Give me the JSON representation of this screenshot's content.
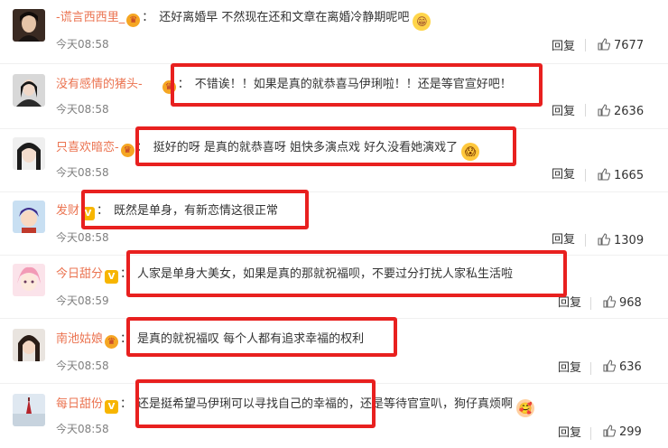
{
  "comments": [
    {
      "user": "-谎言西西里_",
      "badge": "crown",
      "text": "还好离婚早 不然现在还和文章在离婚冷静期呢吧",
      "emoji": "grin-emoji",
      "time": "今天08:58",
      "reply": "回复",
      "likes": "7677"
    },
    {
      "user": "没有感情的猪头-",
      "badge": "crown",
      "text": "不错诶！！如果是真的就恭喜马伊琍啦！！还是等官宣好吧！",
      "time": "今天08:58",
      "reply": "回复",
      "likes": "2636"
    },
    {
      "user": "只喜欢暗恋-",
      "badge": "crown",
      "text": "挺好的呀 是真的就恭喜呀 姐快多演点戏 好久没看她演戏了",
      "emoji": "surprised-emoji",
      "time": "今天08:58",
      "reply": "回复",
      "likes": "1665"
    },
    {
      "user": "发财",
      "badge": "v",
      "text": "既然是单身，有新恋情这很正常",
      "time": "今天08:58",
      "reply": "回复",
      "likes": "1309"
    },
    {
      "user": "今日甜分",
      "badge": "v",
      "text": "人家是单身大美女，如果是真的那就祝福呗，不要过分打扰人家私生活啦",
      "time": "今天08:59",
      "reply": "回复",
      "likes": "968"
    },
    {
      "user": "南池姑娘",
      "badge": "crown",
      "text": "是真的就祝福叹 每个人都有追求幸福的权利",
      "time": "今天08:58",
      "reply": "回复",
      "likes": "636"
    },
    {
      "user": "每日甜份",
      "badge": "v",
      "text": "还是挺希望马伊琍可以寻找自己的幸福的，还是等待官宣叭，狗仔真烦啊",
      "emoji": "blush-emoji",
      "time": "今天08:58",
      "reply": "回复",
      "likes": "299"
    }
  ],
  "colors": {
    "username": "#eb7350",
    "highlight": "#e8201f",
    "meta": "#808080"
  }
}
